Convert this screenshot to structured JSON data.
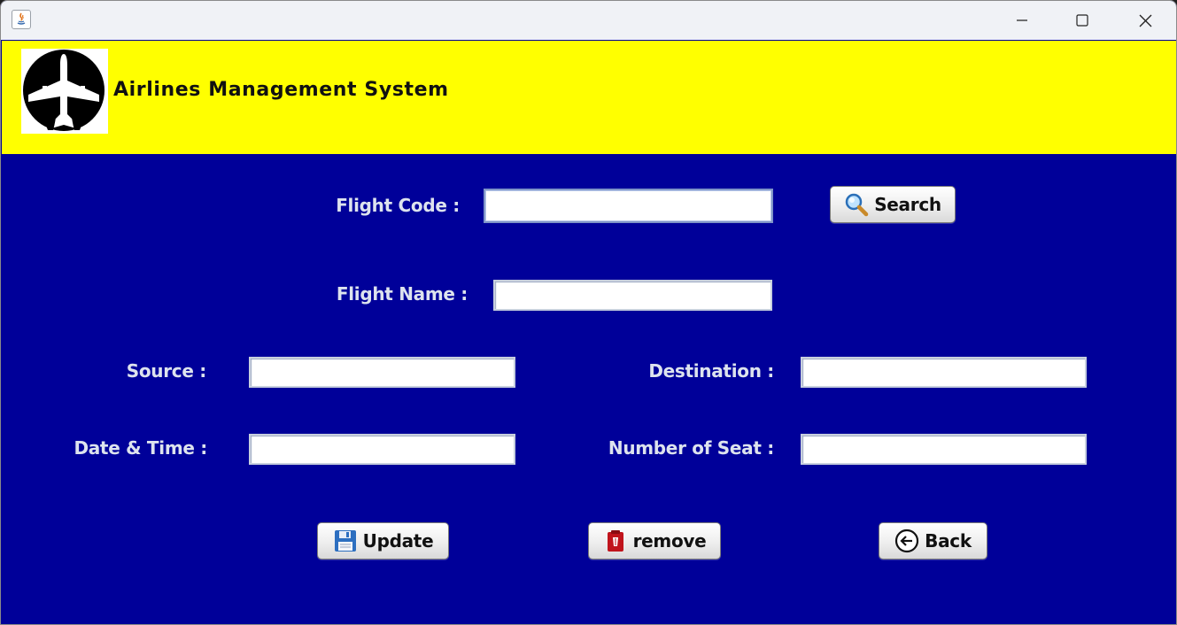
{
  "window": {
    "title": "",
    "controls": {
      "minimize": "minimize",
      "maximize": "maximize",
      "close": "close"
    }
  },
  "header": {
    "title": "Airlines Management System",
    "background": "#ffff00",
    "logo_icon": "airplane-logo-icon"
  },
  "form": {
    "background": "#000099",
    "flight_code": {
      "label": "Flight Code :",
      "value": ""
    },
    "flight_name": {
      "label": "Flight Name :",
      "value": ""
    },
    "source": {
      "label": "Source :",
      "value": ""
    },
    "destination": {
      "label": "Destination :",
      "value": ""
    },
    "date_time": {
      "label": "Date & Time :",
      "value": ""
    },
    "number_of_seat": {
      "label": "Number of Seat :",
      "value": ""
    }
  },
  "buttons": {
    "search": {
      "label": "Search",
      "icon": "magnifier-icon"
    },
    "update": {
      "label": "Update",
      "icon": "floppy-disk-icon"
    },
    "remove": {
      "label": "remove",
      "icon": "trash-icon"
    },
    "back": {
      "label": "Back",
      "icon": "back-arrow-icon"
    }
  }
}
